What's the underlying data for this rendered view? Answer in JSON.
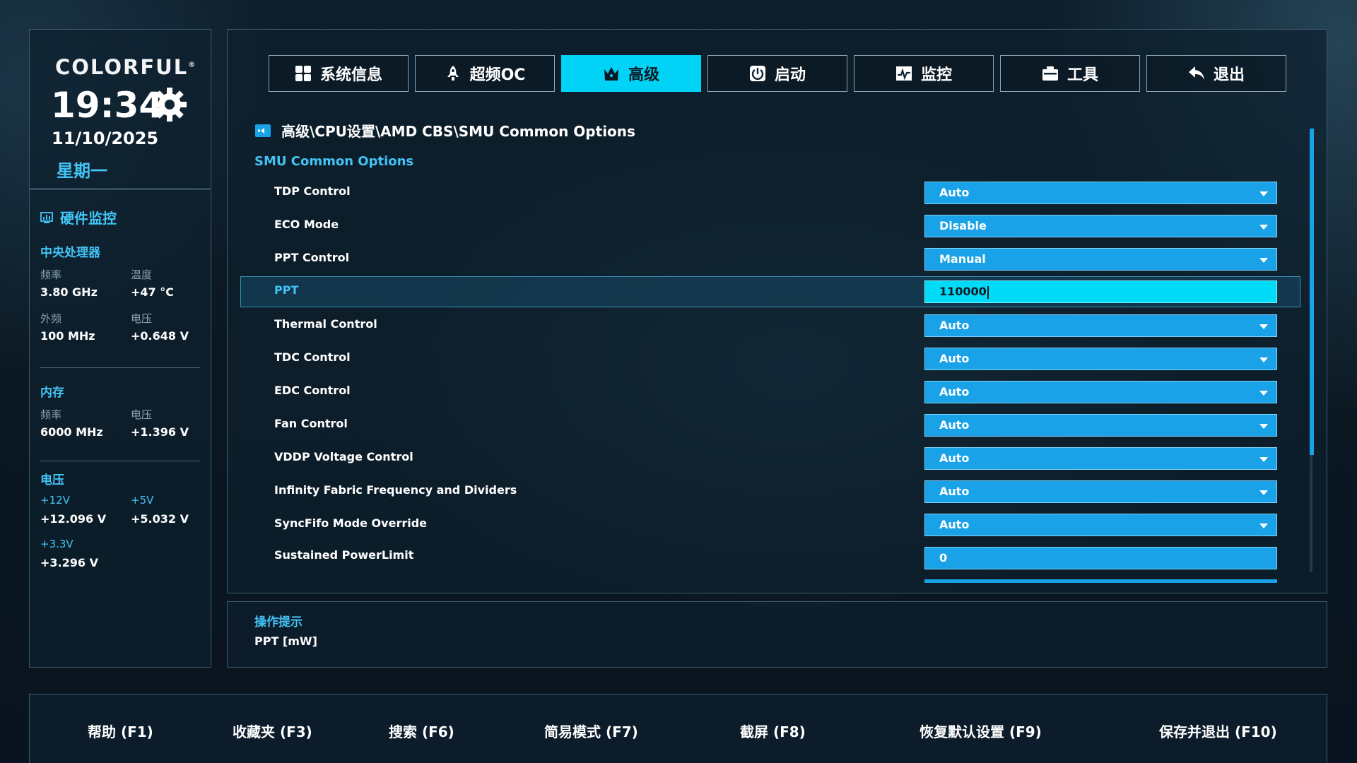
{
  "sidebar": {
    "logo": "COLORFUL",
    "logo_mark": "®",
    "time": "19:34",
    "date": "11/10/2025",
    "weekday": "星期一",
    "hw_title": "硬件监控",
    "cpu": {
      "title": "中央处理器",
      "freq_label": "频率",
      "freq_value": "3.80 GHz",
      "temp_label": "温度",
      "temp_value": "+47 °C",
      "bclk_label": "外频",
      "bclk_value": "100 MHz",
      "volt_label": "电压",
      "volt_value": "+0.648 V"
    },
    "memory": {
      "title": "内存",
      "freq_label": "频率",
      "freq_value": "6000 MHz",
      "volt_label": "电压",
      "volt_value": "+1.396 V"
    },
    "voltage": {
      "title": "电压",
      "v12_label": "+12V",
      "v12_value": "+12.096 V",
      "v5_label": "+5V",
      "v5_value": "+5.032 V",
      "v33_label": "+3.3V",
      "v33_value": "+3.296 V"
    }
  },
  "tabs": [
    {
      "label": "系统信息",
      "icon": "grid-icon"
    },
    {
      "label": "超频OC",
      "icon": "rocket-icon"
    },
    {
      "label": "高级",
      "icon": "crown-icon"
    },
    {
      "label": "启动",
      "icon": "power-icon"
    },
    {
      "label": "监控",
      "icon": "monitor-chart-icon"
    },
    {
      "label": "工具",
      "icon": "toolbox-icon"
    },
    {
      "label": "退出",
      "icon": "return-icon"
    }
  ],
  "active_tab": "高级",
  "main": {
    "breadcrumb": "高级\\CPU设置\\AMD CBS\\SMU Common Options",
    "section_title": "SMU Common Options",
    "settings": [
      {
        "label": "TDP Control",
        "value": "Auto"
      },
      {
        "label": "ECO Mode",
        "value": "Disable"
      },
      {
        "label": "PPT Control",
        "value": "Manual"
      },
      {
        "label": "PPT",
        "value": "110000"
      },
      {
        "label": "Thermal Control",
        "value": "Auto"
      },
      {
        "label": "TDC Control",
        "value": "Auto"
      },
      {
        "label": "EDC Control",
        "value": "Auto"
      },
      {
        "label": "Fan Control",
        "value": "Auto"
      },
      {
        "label": "VDDP Voltage Control",
        "value": "Auto"
      },
      {
        "label": "Infinity Fabric Frequency and Dividers",
        "value": "Auto"
      },
      {
        "label": "SyncFifo Mode Override",
        "value": "Auto"
      },
      {
        "label": "Sustained PowerLimit",
        "value": "0"
      }
    ]
  },
  "hint": {
    "title": "操作提示",
    "text": "PPT [mW]"
  },
  "footer": [
    "帮助 (F1)",
    "收藏夹 (F3)",
    "搜索 (F6)",
    "简易模式 (F7)",
    "截屏 (F8)",
    "恢复默认设置 (F9)",
    "保存并退出 (F10)"
  ],
  "colors": {
    "accent": "#42c4f5",
    "active_tab": "#00d3f5",
    "dropdown": "#1aa2e8",
    "background": "#0b1822"
  }
}
